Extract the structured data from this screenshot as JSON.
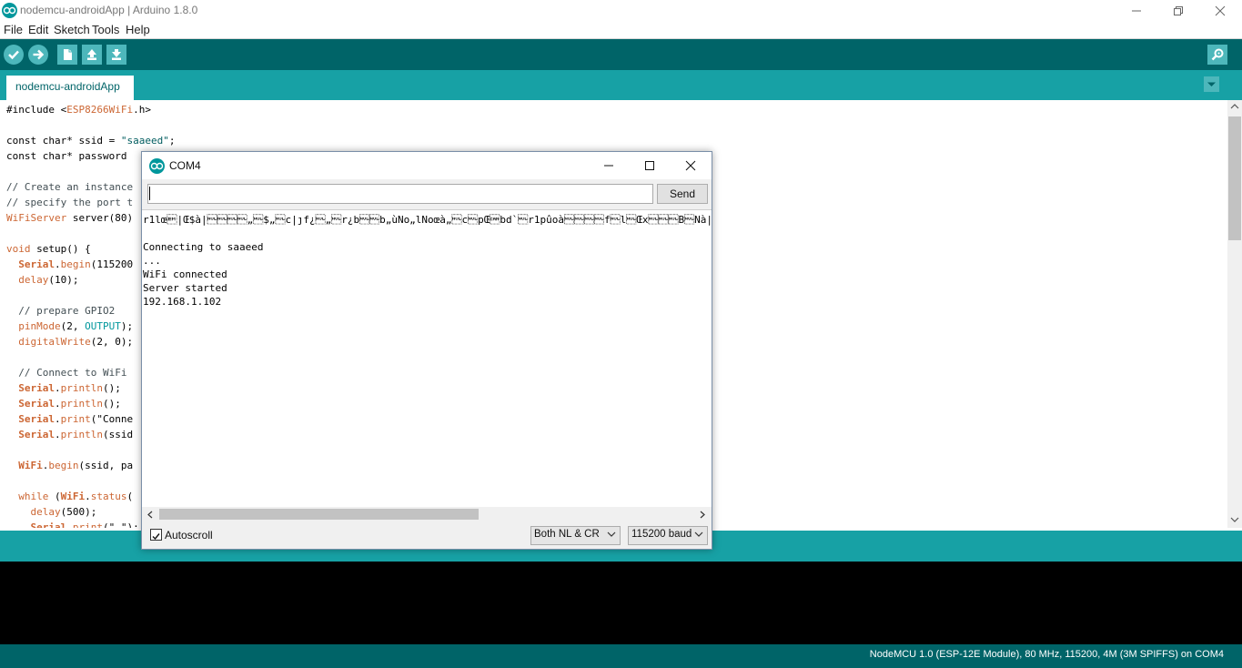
{
  "window": {
    "title": "nodemcu-androidApp | Arduino 1.8.0"
  },
  "menu": [
    "File",
    "Edit",
    "Sketch",
    "Tools",
    "Help"
  ],
  "toolbar": {
    "buttons": [
      "verify-icon",
      "upload-icon",
      "new-icon",
      "open-icon",
      "save-icon"
    ],
    "serial_monitor": "serial-monitor-icon"
  },
  "tabs": [
    {
      "label": "nodemcu-androidApp"
    }
  ],
  "editor": {
    "lines": [
      "#include <ESP8266WiFi.h>",
      "",
      "const char* ssid = \"saaeed\";",
      "const char* password",
      "",
      "// Create an instance",
      "// specify the port t",
      "WiFiServer server(80)",
      "",
      "void setup() {",
      "  Serial.begin(115200",
      "  delay(10);",
      "",
      "  // prepare GPIO2",
      "  pinMode(2, OUTPUT);",
      "  digitalWrite(2, 0);",
      "",
      "  // Connect to WiFi ",
      "  Serial.println();",
      "  Serial.println();",
      "  Serial.print(\"Conne",
      "  Serial.println(ssid",
      "",
      "  WiFi.begin(ssid, pa",
      "",
      "  while (WiFi.status(",
      "    delay(500);",
      "    Serial.print(\".\");"
    ]
  },
  "serial_monitor": {
    "title": "COM4",
    "input_value": "",
    "send_label": "Send",
    "output": [
      "r1lœ\u0019|Œ$à|\u0000\u0000\u0000\u0000„\u0000$„\u0000c|ȷf¿\u0000„\u0000r¿b\u0000\u0000b„ùNo„lNoœà„\u0000c\u0000pŒ\u0018bd`\u0000r1pûoà\u0000\u0000\u0000\u0000f\u0000l\u0000Œx\u0000\u0000\u0000B\u0000Nà|\u0000l„\u0000à\u0000ȷb„ùo:",
      "",
      "Connecting to saaeed",
      "...",
      "WiFi connected",
      "Server started",
      "192.168.1.102"
    ],
    "autoscroll_label": "Autoscroll",
    "autoscroll_checked": true,
    "line_ending": "Both NL & CR",
    "baud": "115200 baud"
  },
  "status": {
    "board": "NodeMCU 1.0 (ESP-12E Module), 80 MHz, 115200, 4M (3M SPIFFS) on COM4"
  },
  "colors": {
    "toolbar": "#006468",
    "tabbar": "#17a1a5",
    "button": "#4db7bb",
    "keyword": "#cc6633"
  }
}
